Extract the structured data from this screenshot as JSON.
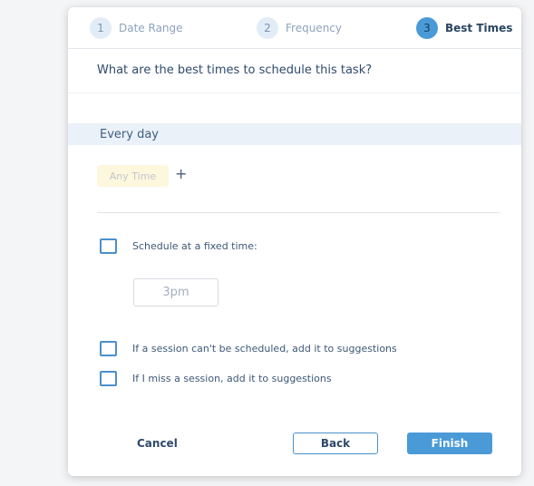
{
  "stepper": {
    "steps": [
      {
        "number": "1",
        "label": "Date Range"
      },
      {
        "number": "2",
        "label": "Frequency"
      },
      {
        "number": "3",
        "label": "Best Times"
      }
    ]
  },
  "question": "What are the best times to schedule this task?",
  "schedule": {
    "day_label": "Every day",
    "chip_label": "Any Time",
    "add_symbol": "+"
  },
  "options": {
    "fixed_time_label": "Schedule at a fixed time:",
    "fixed_time_placeholder": "3pm",
    "cant_schedule_label": "If a session can't be scheduled, add it to suggestions",
    "miss_session_label": "If I miss a session, add it to suggestions"
  },
  "footer": {
    "cancel_label": "Cancel",
    "back_label": "Back",
    "finish_label": "Finish"
  },
  "colors": {
    "accent": "#4b9ad8",
    "checkbox_border": "#4b8fcc",
    "band_bg": "#eaf1f8",
    "chip_bg": "#fdf7dd"
  }
}
